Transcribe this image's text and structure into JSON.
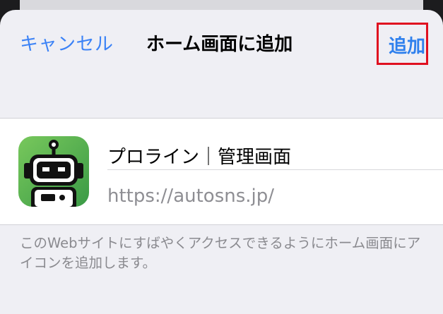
{
  "nav": {
    "cancel_label": "キャンセル",
    "title": "ホーム画面に追加",
    "add_label": "追加"
  },
  "bookmark": {
    "name": "プロライン｜管理画面",
    "url": "https://autosns.jp/",
    "icon": "robot-icon"
  },
  "description": "このWebサイトにすばやくアクセスできるようにホーム画面にアイコンを追加します。",
  "colors": {
    "accent": "#2f80ed",
    "highlight_border": "#e01020",
    "icon_green": "#5cb85c"
  }
}
